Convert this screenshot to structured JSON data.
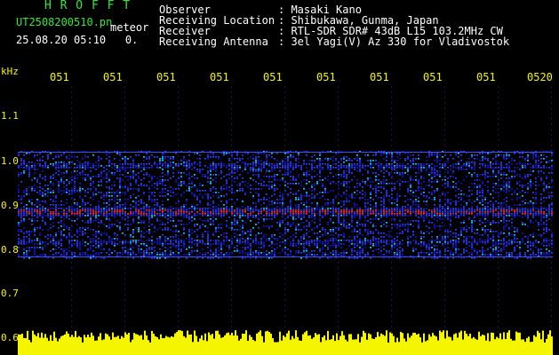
{
  "header": {
    "brand": "H R O F F T",
    "filename": "UT2508200510.pn",
    "tag": "meteor",
    "datetime": "25.08.20 05:10   0.",
    "fields": [
      {
        "label": "Observer",
        "value": ": Masaki Kano"
      },
      {
        "label": "Receiving Location",
        "value": ": Shibukawa, Gunma, Japan"
      },
      {
        "label": "Receiver",
        "value": ": RTL-SDR SDR# 43dB L15 103.2MHz CW"
      },
      {
        "label": "Receiving Antenna",
        "value": ": 3el Yagi(V) Az 330 for Vladivostok"
      }
    ]
  },
  "axis": {
    "y_unit": "kHz",
    "y_ticks": [
      "1.1",
      "1.0",
      "0.9",
      "0.8",
      "0.7",
      "0.6"
    ],
    "x_ticks": [
      "051",
      "051",
      "051",
      "051",
      "051",
      "051",
      "051",
      "051",
      "051",
      "0520"
    ]
  },
  "colors": {
    "text_header": "#34e834",
    "text_info": "#ffffff",
    "tick_text": "#f5f500",
    "background": "#000000",
    "signal_low": "#1010c0",
    "signal_high": "#ff2040",
    "noise_floor": "#f5f500"
  }
}
